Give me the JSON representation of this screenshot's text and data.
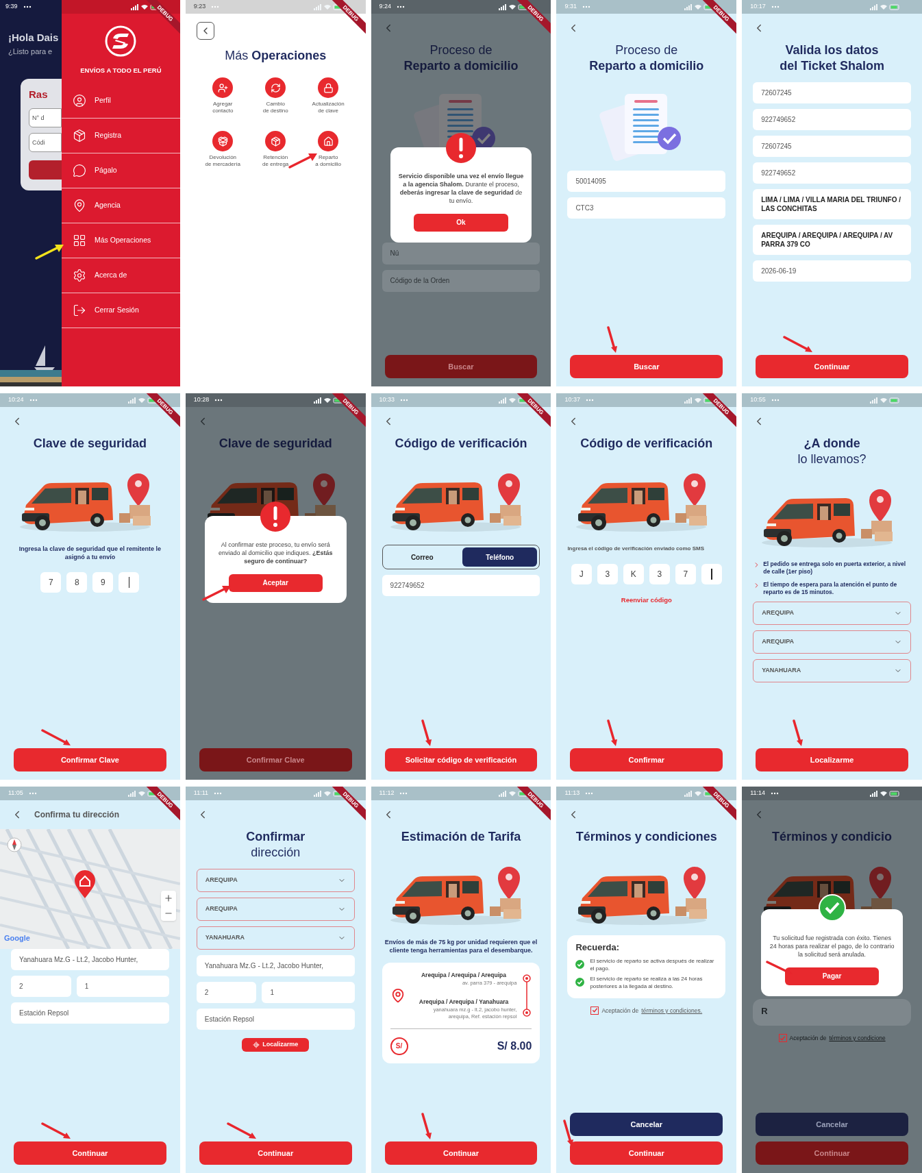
{
  "screens": [
    {
      "kind": "drawer",
      "status": {
        "time": "9:39"
      },
      "debug": "DEBUG",
      "home": {
        "greeting": "¡Hola Dais",
        "subtitle": "¿Listo para e",
        "card_title": "Ras",
        "fields": [
          {
            "placeholder": "N° d"
          },
          {
            "placeholder": "Códi"
          }
        ]
      },
      "drawer": {
        "tagline": "ENVÍOS A TODO EL PERÚ",
        "items": [
          {
            "label": "Perfil"
          },
          {
            "label": "Registra"
          },
          {
            "label": "Págalo"
          },
          {
            "label": "Agencia"
          },
          {
            "label": "Más Operaciones",
            "arrow": {
              "kind": "rising",
              "color": "#f2e21c"
            }
          },
          {
            "label": "Acerca de"
          },
          {
            "label": "Cerrar Sesión"
          }
        ]
      }
    },
    {
      "kind": "menu",
      "status": {
        "time": "9:23"
      },
      "debug": "DEBUG",
      "dimmed": false,
      "blocks": [
        {
          "kind": "boxed_back"
        },
        {
          "kind": "title",
          "text": "Más **Operaciones**"
        },
        {
          "kind": "grid",
          "items": [
            {
              "label": "Agregar\ncontacto"
            },
            {
              "label": "Cambio\nde destino"
            },
            {
              "label": "Actualización\nde clave"
            },
            {
              "label": "Devolución\nde mercadería"
            },
            {
              "label": "Retención\nde entrega"
            },
            {
              "label": "Reparto\na domicilio",
              "arrow": {
                "kind": "rising",
                "color": "#e8262d"
              }
            }
          ]
        }
      ]
    },
    {
      "kind": "page",
      "status": {
        "time": "9:24"
      },
      "debug": "DEBUG",
      "dimmed": true,
      "blocks": [
        {
          "kind": "back"
        },
        {
          "kind": "title",
          "text": "Proceso de\n**Reparto a domicilio**"
        },
        {
          "kind": "documents"
        },
        {
          "kind": "alert_dialog",
          "text": "**Servicio disponible una vez el envío llegue a la agencia Shalom.** Durante el proceso, **deberás ingresar la clave de seguridad** de tu envío.",
          "button": "Ok"
        },
        {
          "kind": "field",
          "placeholder": "Nú"
        },
        {
          "kind": "field",
          "placeholder": "Código de la Orden"
        },
        {
          "kind": "spacer"
        },
        {
          "kind": "button",
          "label": "Buscar"
        }
      ]
    },
    {
      "kind": "page",
      "status": {
        "time": "9:31"
      },
      "debug": "DEBUG",
      "dimmed": false,
      "blocks": [
        {
          "kind": "back"
        },
        {
          "kind": "title",
          "text": "Proceso de\n**Reparto a domicilio**"
        },
        {
          "kind": "documents"
        },
        {
          "kind": "field",
          "value": "50014095"
        },
        {
          "kind": "field",
          "value": "CTC3"
        },
        {
          "kind": "spacer"
        },
        {
          "kind": "button",
          "label": "Buscar",
          "arrow": {
            "kind": "vertical",
            "color": "#e8262d"
          }
        }
      ]
    },
    {
      "kind": "page",
      "status": {
        "time": "10:17"
      },
      "dimmed": false,
      "blocks": [
        {
          "kind": "back"
        },
        {
          "kind": "headline",
          "text": "Valida los datos\ndel Ticket Shalom"
        },
        {
          "kind": "field",
          "value": "72607245"
        },
        {
          "kind": "field",
          "value": "922749652"
        },
        {
          "kind": "field",
          "value": "72607245"
        },
        {
          "kind": "field",
          "value": "922749652"
        },
        {
          "kind": "address_field",
          "value": "LIMA / LIMA / VILLA MARIA DEL TRIUNFO / LAS CONCHITAS"
        },
        {
          "kind": "address_field",
          "value": "AREQUIPA / AREQUIPA / AREQUIPA / AV PARRA 379 CO"
        },
        {
          "kind": "field",
          "value": "2026-06-19"
        },
        {
          "kind": "spacer"
        },
        {
          "kind": "button",
          "label": "Continuar",
          "arrow": {
            "kind": "diagonal",
            "color": "#e8262d"
          }
        }
      ]
    },
    {
      "kind": "page",
      "status": {
        "time": "10:24"
      },
      "debug": "DEBUG",
      "dimmed": false,
      "blocks": [
        {
          "kind": "back"
        },
        {
          "kind": "headline",
          "text": "Clave de seguridad"
        },
        {
          "kind": "van"
        },
        {
          "kind": "note",
          "text": "Ingresa la clave de seguridad que el remitente le asignó a tu envío"
        },
        {
          "kind": "code",
          "digits": [
            "7",
            "8",
            "9"
          ],
          "cursor": true
        },
        {
          "kind": "spacer"
        },
        {
          "kind": "button",
          "label": "Confirmar Clave",
          "arrow": {
            "kind": "diagonal",
            "color": "#e8262d"
          }
        }
      ]
    },
    {
      "kind": "page",
      "status": {
        "time": "10:28"
      },
      "debug": "DEBUG",
      "dimmed": true,
      "blocks": [
        {
          "kind": "back"
        },
        {
          "kind": "headline",
          "text": "Clave de seguridad"
        },
        {
          "kind": "van"
        },
        {
          "kind": "alert_dialog",
          "text": "Al confirmar este proceso, tu envío será enviado al domicilio que indiques. **¿Estás seguro de continuar?**",
          "button": "Aceptar",
          "arrow": {
            "kind": "rising",
            "color": "#e8262d"
          }
        },
        {
          "kind": "spacer"
        },
        {
          "kind": "button",
          "label": "Confirmar Clave"
        }
      ]
    },
    {
      "kind": "page",
      "status": {
        "time": "10:33"
      },
      "debug": "DEBUG",
      "dimmed": false,
      "blocks": [
        {
          "kind": "back"
        },
        {
          "kind": "headline",
          "text": "Código de verificación"
        },
        {
          "kind": "van"
        },
        {
          "kind": "segmented",
          "options": [
            {
              "label": "Correo",
              "selected": false
            },
            {
              "label": "Teléfono",
              "selected": true
            }
          ]
        },
        {
          "kind": "field",
          "value": "922749652"
        },
        {
          "kind": "spacer"
        },
        {
          "kind": "button",
          "label": "Solicitar código de verificación",
          "arrow": {
            "kind": "vertical",
            "color": "#e8262d"
          }
        }
      ]
    },
    {
      "kind": "page",
      "status": {
        "time": "10:37"
      },
      "debug": "DEBUG",
      "dimmed": false,
      "blocks": [
        {
          "kind": "back"
        },
        {
          "kind": "headline",
          "text": "Código de verificación"
        },
        {
          "kind": "van"
        },
        {
          "kind": "hint",
          "text": "Ingresa el código de verificación enviado como SMS"
        },
        {
          "kind": "code",
          "digits": [
            "J",
            "3",
            "K",
            "3",
            "7"
          ],
          "cursor": true
        },
        {
          "kind": "link",
          "text": "Reenviar código"
        },
        {
          "kind": "spacer"
        },
        {
          "kind": "button",
          "label": "Confirmar",
          "arrow": {
            "kind": "vertical",
            "color": "#e8262d"
          }
        }
      ]
    },
    {
      "kind": "page",
      "status": {
        "time": "10:55"
      },
      "dimmed": false,
      "blocks": [
        {
          "kind": "back"
        },
        {
          "kind": "title",
          "text": "**¿A donde**\nlo llevamos?"
        },
        {
          "kind": "van"
        },
        {
          "kind": "bullets",
          "items": [
            "El pedido se entrega solo en puerta exterior, a nivel de calle (1er piso)",
            "El tiempo de espera para la atención el punto de reparto es de 15 minutos."
          ]
        },
        {
          "kind": "select",
          "value": "AREQUIPA"
        },
        {
          "kind": "select",
          "value": "AREQUIPA"
        },
        {
          "kind": "select",
          "value": "YANAHUARA"
        },
        {
          "kind": "spacer"
        },
        {
          "kind": "button",
          "label": "Localizarme",
          "arrow": {
            "kind": "vertical",
            "color": "#e8262d"
          }
        }
      ]
    },
    {
      "kind": "page",
      "status": {
        "time": "11:05"
      },
      "debug": "DEBUG",
      "dimmed": false,
      "blocks": [
        {
          "kind": "header_bar",
          "text": "Confirma tu dirección"
        },
        {
          "kind": "map",
          "attribution": "Google"
        },
        {
          "kind": "field",
          "value": "Yanahuara Mz.G - Lt.2, Jacobo Hunter,"
        },
        {
          "kind": "field_row",
          "values": [
            "2",
            "1"
          ]
        },
        {
          "kind": "field",
          "value": "Estación Repsol"
        },
        {
          "kind": "spacer"
        },
        {
          "kind": "button",
          "label": "Continuar",
          "arrow": {
            "kind": "diagonal",
            "color": "#e8262d"
          }
        }
      ]
    },
    {
      "kind": "page",
      "status": {
        "time": "11:11"
      },
      "debug": "DEBUG",
      "dimmed": false,
      "blocks": [
        {
          "kind": "back"
        },
        {
          "kind": "title",
          "text": "**Confirmar**\ndirección"
        },
        {
          "kind": "select",
          "value": "AREQUIPA"
        },
        {
          "kind": "select",
          "value": "AREQUIPA"
        },
        {
          "kind": "select",
          "value": "YANAHUARA"
        },
        {
          "kind": "field",
          "value": "Yanahuara Mz.G - Lt.2, Jacobo Hunter,"
        },
        {
          "kind": "field_row",
          "values": [
            "2",
            "1"
          ]
        },
        {
          "kind": "field",
          "value": "Estación Repsol"
        },
        {
          "kind": "chip",
          "label": "Localizarme"
        },
        {
          "kind": "spacer"
        },
        {
          "kind": "button",
          "label": "Continuar",
          "arrow": {
            "kind": "diagonal",
            "color": "#e8262d"
          }
        }
      ]
    },
    {
      "kind": "page",
      "status": {
        "time": "11:12"
      },
      "debug": "DEBUG",
      "dimmed": false,
      "blocks": [
        {
          "kind": "back"
        },
        {
          "kind": "headline",
          "text": "Estimación de Tarifa"
        },
        {
          "kind": "van"
        },
        {
          "kind": "note",
          "text": "Envíos de más de 75 kg por unidad requieren que el cliente tenga herramientas para el desembarque."
        },
        {
          "kind": "route",
          "stops": [
            {
              "title": "Arequipa / Arequipa / Arequipa",
              "detail": "av. parra 379 - arequipa"
            },
            {
              "title": "Arequipa / Arequipa / Yanahuara",
              "detail": "yanahuara mz.g - lt.2, jacobo hunter, arequipa, Ref. estación repsol"
            }
          ],
          "currency": "S/",
          "price": "S/ 8.00"
        },
        {
          "kind": "spacer"
        },
        {
          "kind": "button",
          "label": "Continuar",
          "arrow": {
            "kind": "vertical",
            "color": "#e8262d"
          }
        }
      ]
    },
    {
      "kind": "page",
      "status": {
        "time": "11:13"
      },
      "debug": "DEBUG",
      "dimmed": false,
      "blocks": [
        {
          "kind": "back"
        },
        {
          "kind": "headline",
          "text": "Términos y condiciones"
        },
        {
          "kind": "van"
        },
        {
          "kind": "reminder",
          "title": "Recuerda:",
          "items": [
            "El servicio de reparto se activa después de realizar el pago.",
            "El servicio de reparto se realiza a las 24 horas posteriores a la llegada al destino."
          ]
        },
        {
          "kind": "checkbox",
          "checked": true,
          "text": "Aceptación de",
          "link": "términos y condiciones."
        },
        {
          "kind": "spacer"
        },
        {
          "kind": "dark_button",
          "label": "Cancelar"
        },
        {
          "kind": "button",
          "label": "Continuar",
          "arrow": {
            "kind": "edge",
            "color": "#e8262d"
          }
        }
      ]
    },
    {
      "kind": "page",
      "status": {
        "time": "11:14"
      },
      "dimmed": true,
      "blocks": [
        {
          "kind": "back"
        },
        {
          "kind": "headline",
          "text": "Términos y condicio"
        },
        {
          "kind": "van"
        },
        {
          "kind": "success_dialog",
          "text": "Tu solicitud fue registrada con éxito. Tienes 24 horas para realizar el pago, de lo contrario la solicitud será anulada.",
          "button": "Pagar",
          "arrow": {
            "kind": "side",
            "color": "#e8262d"
          }
        },
        {
          "kind": "reminder",
          "title": "R"
        },
        {
          "kind": "checkbox",
          "checked": true,
          "text": "Aceptación de",
          "link": "términos y condicione"
        },
        {
          "kind": "spacer"
        },
        {
          "kind": "dark_button",
          "label": "Cancelar"
        },
        {
          "kind": "button",
          "label": "Continuar"
        }
      ]
    }
  ]
}
